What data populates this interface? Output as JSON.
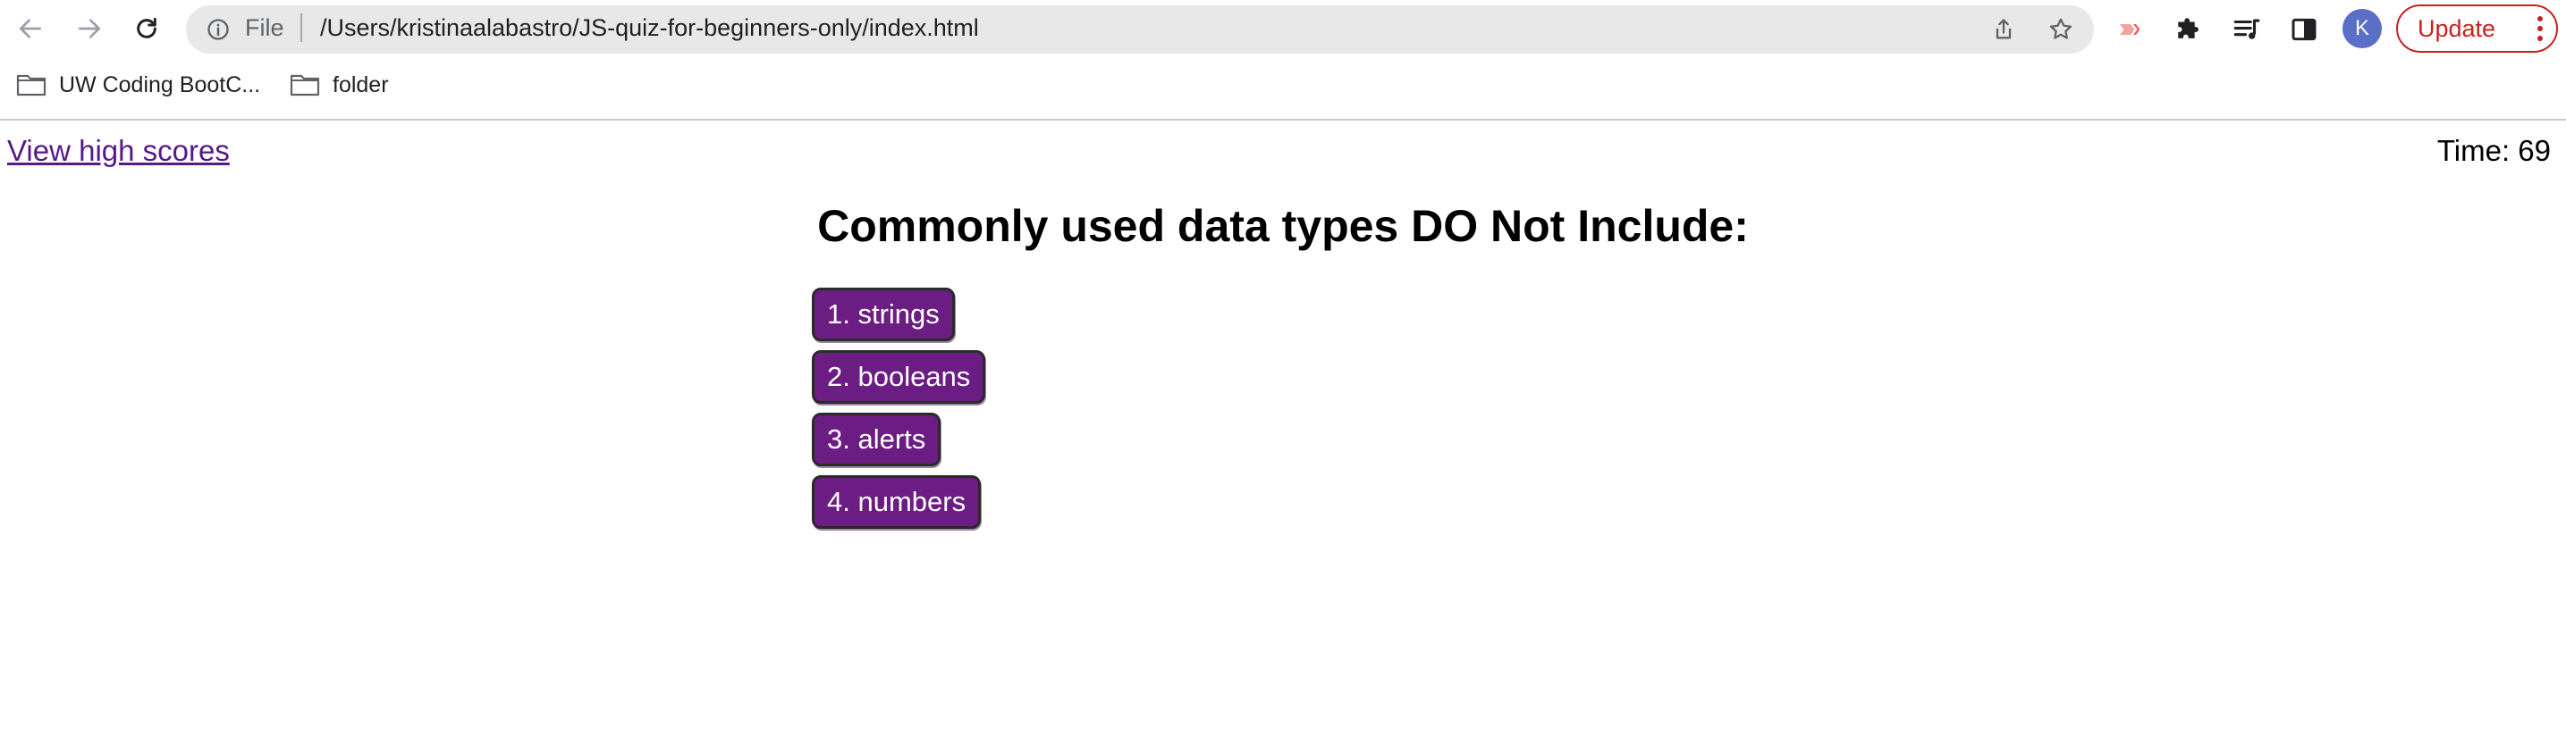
{
  "browser": {
    "omnibox": {
      "scheme_label": "File",
      "url": "/Users/kristinaalabastro/JS-quiz-for-beginners-only/index.html"
    },
    "update_label": "Update",
    "profile_initial": "K",
    "bookmarks": [
      {
        "label": "UW Coding BootC..."
      },
      {
        "label": "folder"
      }
    ],
    "icons": {
      "back": "arrow-left-icon",
      "forward": "arrow-right-icon",
      "reload": "reload-icon",
      "info": "info-icon",
      "share": "share-icon",
      "bookmark_star": "star-icon",
      "extension_red": "extension-icon",
      "extensions": "puzzle-icon",
      "reading_list": "reading-list-icon",
      "side_panel": "side-panel-icon",
      "menu": "more-vertical-icon"
    },
    "colors": {
      "update_red": "#c5221f",
      "avatar_blue": "#5b6fc7"
    }
  },
  "quiz": {
    "high_scores_link": "View high scores",
    "timer_text": "Time: 69",
    "question": "Commonly used data types DO Not Include:",
    "answers": [
      {
        "label": "1. strings"
      },
      {
        "label": "2. booleans"
      },
      {
        "label": "3. alerts"
      },
      {
        "label": "4. numbers"
      }
    ],
    "colors": {
      "button_bg": "#6b1d84",
      "link": "#551a8b"
    }
  }
}
